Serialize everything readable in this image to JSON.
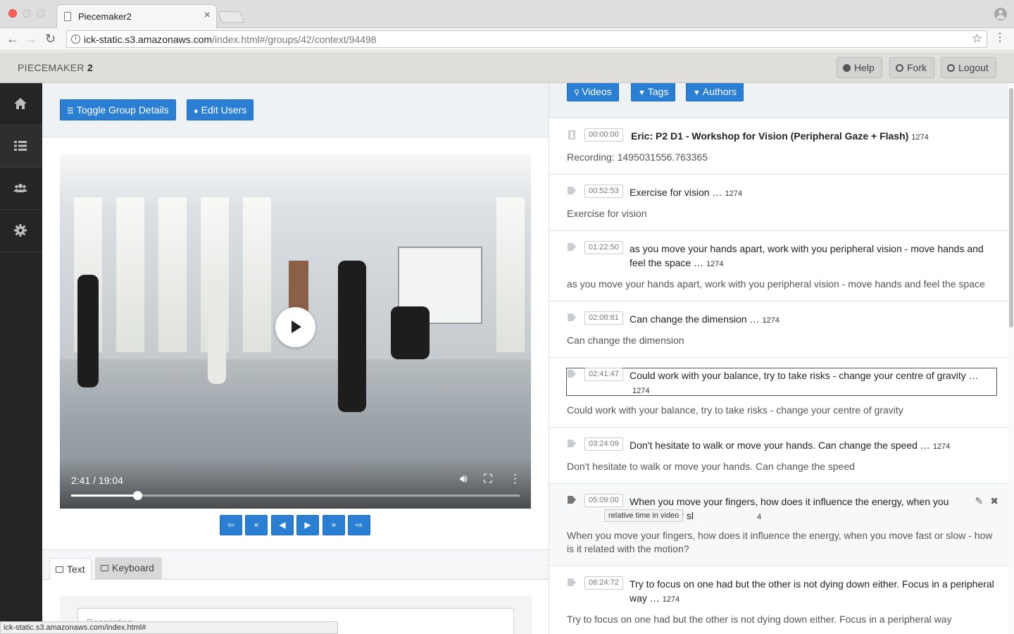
{
  "browser": {
    "tab_title": "Piecemaker2",
    "tab_close": "×",
    "url_host": "ick-static.s3.amazonaws.com",
    "url_path": "/index.html#/groups/42/context/94498",
    "status_url": "ick-static.s3.amazonaws.com/index.html#"
  },
  "navbar": {
    "brand_prefix": "PIECEMAKER",
    "brand_suffix": "2",
    "help_label": "Help",
    "fork_label": "Fork",
    "logout_label": "Logout"
  },
  "sidebar": {
    "items": [
      {
        "icon": "home-icon"
      },
      {
        "icon": "list-icon"
      },
      {
        "icon": "users-icon"
      },
      {
        "icon": "gear-icon"
      }
    ]
  },
  "left": {
    "toggle_group_label": "Toggle Group Details",
    "edit_users_label": "Edit Users",
    "video": {
      "time_display": "2:41 / 19:04",
      "progress_fraction": 0.147
    },
    "transport": [
      "⇦",
      "«",
      "◀",
      "▶",
      "»",
      "⇨"
    ],
    "tabs": {
      "text_label": "Text",
      "keyboard_label": "Keyboard"
    },
    "description_placeholder": "Description"
  },
  "right": {
    "videos_label": "Videos",
    "tags_label": "Tags",
    "authors_label": "Authors",
    "tooltip": "relative time in video",
    "entries": [
      {
        "time": "00:00:00",
        "title": "Eric: P2 D1 - Workshop for Vision (Peripheral Gaze + Flash)",
        "count": "1274",
        "desc": "Recording: 1495031556.763365",
        "icon": "film-icon"
      },
      {
        "time": "00:52:53",
        "title": "Exercise for vision …",
        "count": "1274",
        "desc": "Exercise for vision",
        "icon": "tag-icon"
      },
      {
        "time": "01:22:50",
        "title": "as you move your hands apart, work with you peripheral vision - move hands and feel the space …",
        "count": "1274",
        "desc": "as you move your hands apart, work with you peripheral vision - move hands and feel the space",
        "icon": "tag-icon"
      },
      {
        "time": "02:08:81",
        "title": "Can change the dimension …",
        "count": "1274",
        "desc": "Can change the dimension",
        "icon": "tag-icon"
      },
      {
        "time": "02:41:47",
        "title": "Could work with your balance, try to take risks - change your centre of gravity  …",
        "count": "1274",
        "desc": "Could work with your balance, try to take risks - change your centre of gravity",
        "icon": "tag-icon"
      },
      {
        "time": "03:24:09",
        "title": "Don't hesitate to walk or move your hands. Can change the speed  …",
        "count": "1274",
        "desc": "Don't hesitate to walk or move your hands. Can change the speed",
        "icon": "tag-icon"
      },
      {
        "time": "05:09:00",
        "title_visible": "When you move your fingers, how does it influence the energy, when you move fast or sl",
        "count": "4",
        "desc": "When you move your fingers, how does it influence the energy, when you move fast or slow - how is it related with the motion?",
        "icon": "tag-icon"
      },
      {
        "time": "06:24:72",
        "title": "Try to focus on one had but the other is not dying down either. Focus in a peripheral way  …",
        "count": "1274",
        "desc": "Try to focus on one had but the other is not dying down either. Focus in a peripheral way",
        "icon": "tag-icon"
      }
    ],
    "edit_icon_glyph": "✎",
    "delete_icon_glyph": "✖"
  }
}
